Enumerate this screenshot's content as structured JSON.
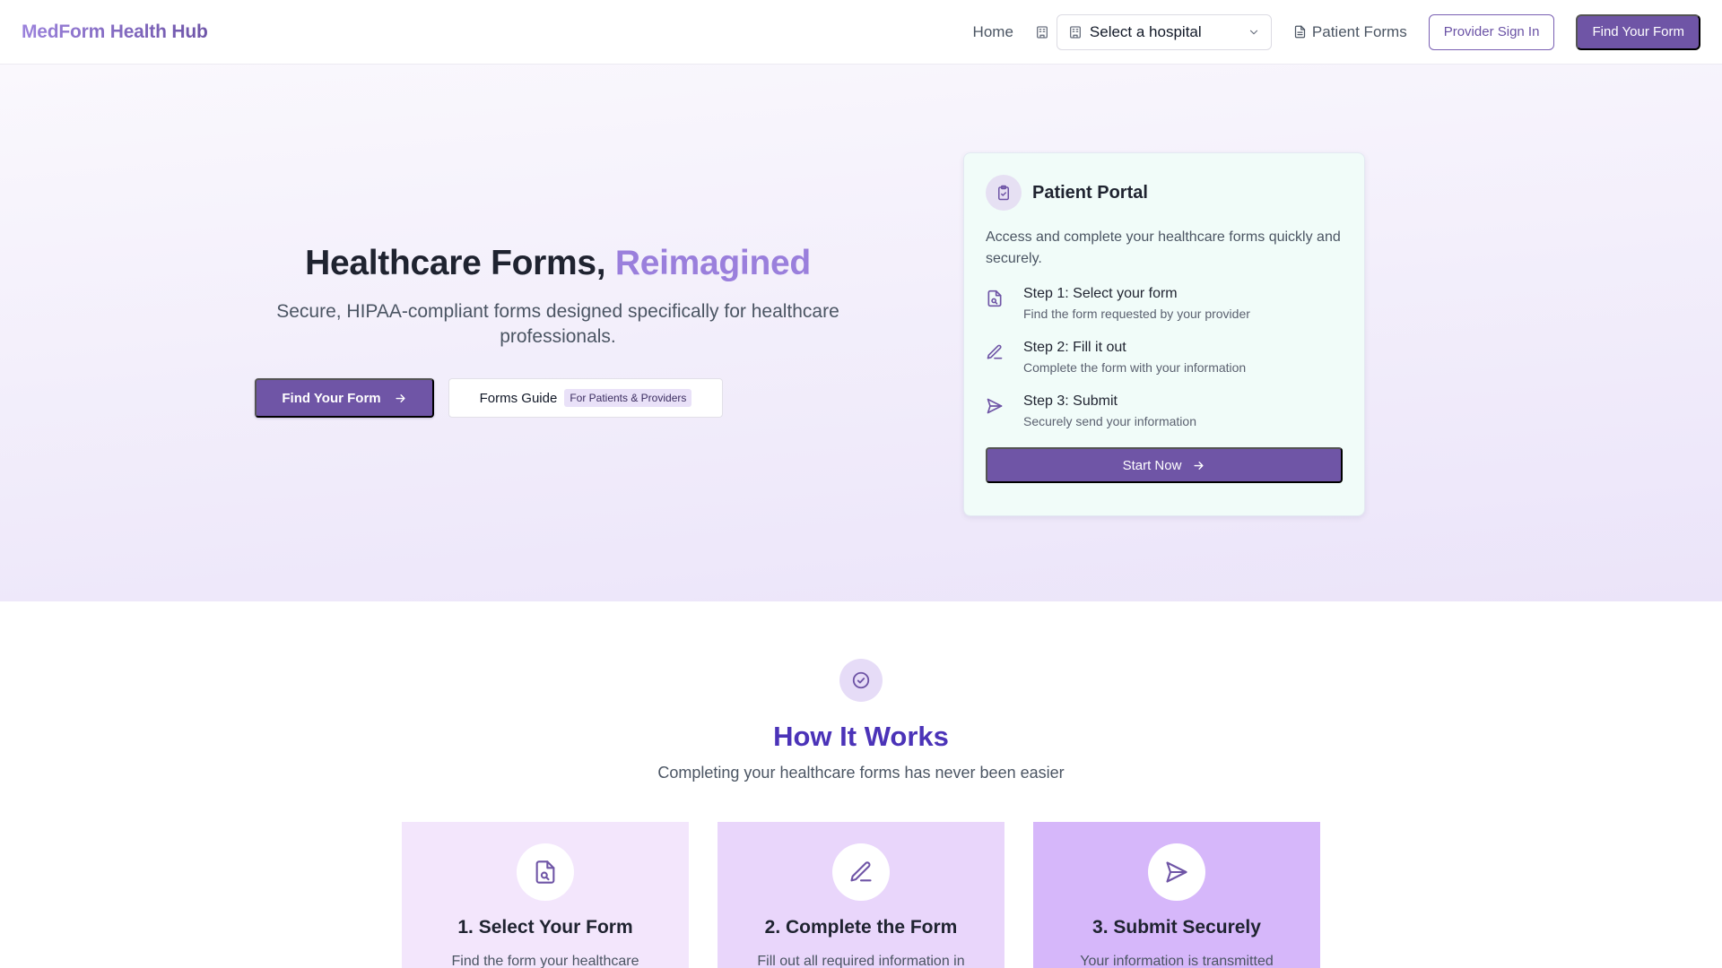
{
  "nav": {
    "brand": "MedForm Health Hub",
    "home": "Home",
    "hospital_select_value": "Select a hospital",
    "patient_forms": "Patient Forms",
    "provider_sign_in": "Provider Sign In",
    "find_your_form": "Find Your Form"
  },
  "hero": {
    "title_main": "Healthcare Forms, ",
    "title_accent": "Reimagined",
    "subtitle": "Secure, HIPAA-compliant forms designed specifically for healthcare professionals.",
    "primary_cta": "Find Your Form",
    "secondary_cta": "Forms Guide",
    "secondary_badge": "For Patients & Providers"
  },
  "portal": {
    "title": "Patient Portal",
    "description": "Access and complete your healthcare forms quickly and securely.",
    "steps": [
      {
        "title": "Step 1: Select your form",
        "text": "Find the form requested by your provider",
        "icon": "file-search-icon"
      },
      {
        "title": "Step 2: Fill it out",
        "text": "Complete the form with your information",
        "icon": "pencil-icon"
      },
      {
        "title": "Step 3: Submit",
        "text": "Securely send your information",
        "icon": "send-icon"
      }
    ],
    "cta": "Start Now"
  },
  "how": {
    "title": "How It Works",
    "subtitle": "Completing your healthcare forms has never been easier",
    "features": [
      {
        "title": "1. Select Your Form",
        "text": "Find the form your healthcare",
        "icon": "file-search-icon",
        "bg": "#f3e6fc"
      },
      {
        "title": "2. Complete the Form",
        "text": "Fill out all required information in",
        "icon": "pencil-icon",
        "bg": "#e9d6fb"
      },
      {
        "title": "3. Submit Securely",
        "text": "Your information is transmitted",
        "icon": "send-icon",
        "bg": "#d6b7fa"
      }
    ]
  },
  "colors": {
    "primary": "#6f55a6",
    "accent": "#9a7fdc",
    "how_title": "#4b33b8"
  }
}
